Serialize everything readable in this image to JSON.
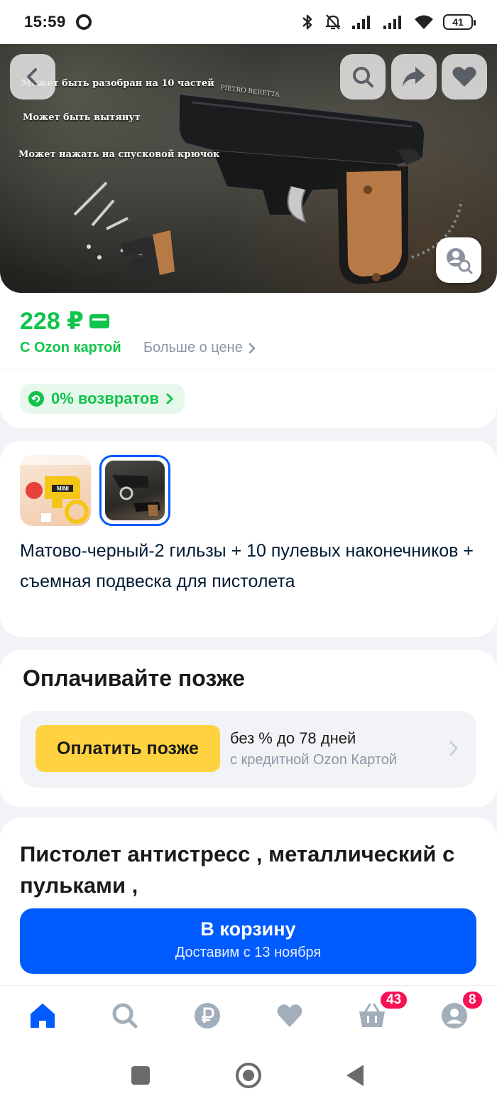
{
  "status_bar": {
    "time": "15:59",
    "battery": "41"
  },
  "hero": {
    "captions": [
      "Может быть разобран на 10 частей",
      "Может быть вытянут",
      "Может нажать на спусковой крючок"
    ],
    "gun_engraving": "PIETRO BERETTA"
  },
  "price": {
    "value": "228 ₽",
    "with_card_label": "С Ozon картой",
    "more_label": "Больше о цене",
    "returns_label": "0% возвратов"
  },
  "variant": {
    "thumb1_label": "MINI",
    "description": "Матово-черный-2 гильзы + 10 пулевых наконечников + съемная подвеска для пистолета"
  },
  "pay_later": {
    "title": "Оплачивайте позже",
    "button_label": "Оплатить позже",
    "line1": "без % до 78 дней",
    "line2": "с кредитной Ozon Картой"
  },
  "product": {
    "title": "Пистолет антистресс , металлический с пульками ,"
  },
  "cart_button": {
    "label": "В корзину",
    "delivery": "Доставим с 13 ноября"
  },
  "tabbar": {
    "cart_badge": "43",
    "profile_badge": "8",
    "accent_color": "#005bff",
    "icon_color": "#a3aebb"
  }
}
